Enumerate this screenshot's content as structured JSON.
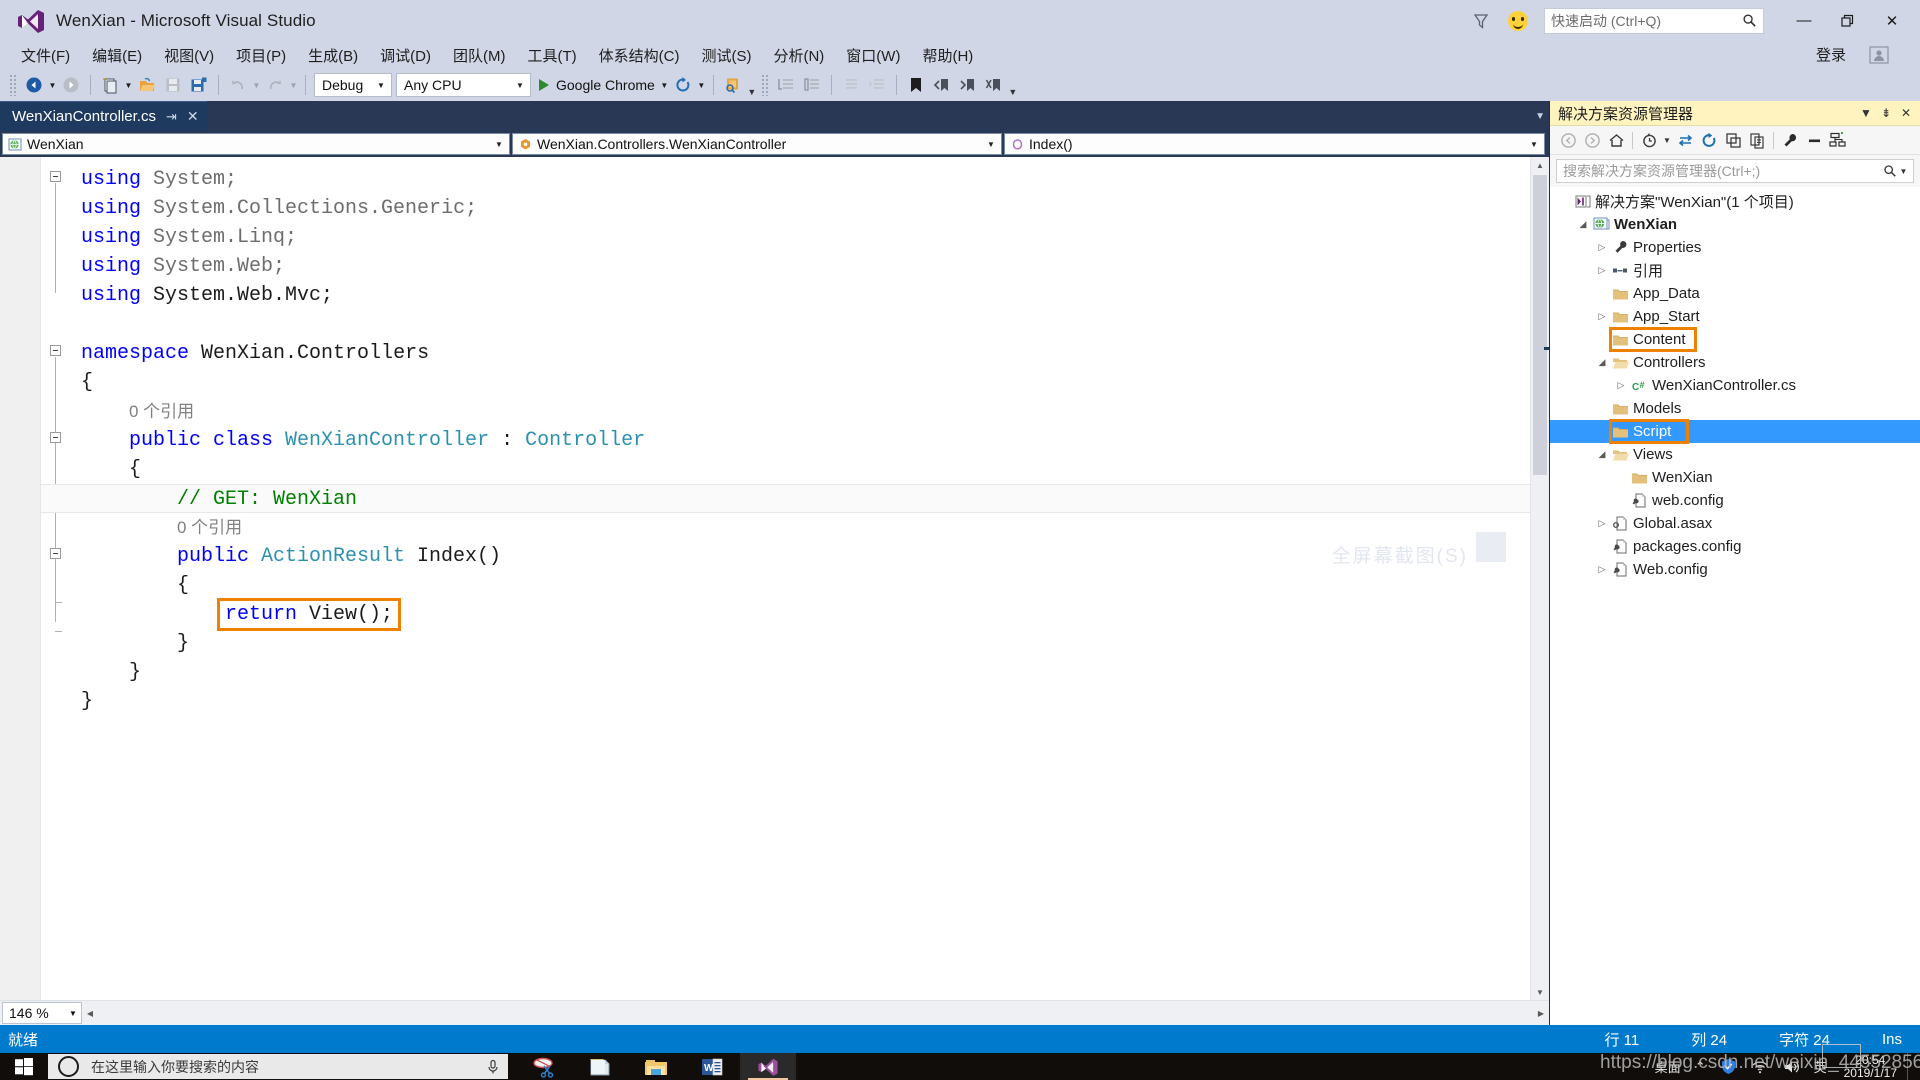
{
  "window": {
    "title": "WenXian - Microsoft Visual Studio",
    "logo_icon": "visual-studio-logo",
    "feedback_icon": "feedback-funnel-icon",
    "smiley_icon": "send-a-smile-icon",
    "minimize": "—",
    "maximize": "❐",
    "close": "✕"
  },
  "quick_launch": {
    "placeholder": "快速启动 (Ctrl+Q)",
    "icon": "search-icon"
  },
  "menu": {
    "items": [
      "文件(F)",
      "编辑(E)",
      "视图(V)",
      "项目(P)",
      "生成(B)",
      "调试(D)",
      "团队(M)",
      "工具(T)",
      "体系结构(C)",
      "测试(S)",
      "分析(N)",
      "窗口(W)",
      "帮助(H)"
    ],
    "signin": "登录",
    "signin_icon": "account-icon"
  },
  "toolbar": {
    "nav_back_icon": "navigate-backward-icon",
    "nav_forward_icon": "navigate-forward-icon",
    "new_project_icon": "new-project-icon",
    "open_file_icon": "open-file-icon",
    "save_icon": "save-icon",
    "save_all_icon": "save-all-icon",
    "undo_icon": "undo-icon",
    "redo_icon": "redo-icon",
    "config": "Debug",
    "platform": "Any CPU",
    "start_label": "Google Chrome",
    "start_icon": "start-debug-icon",
    "refresh_icon": "refresh-icon",
    "find_icon": "find-in-files-icon",
    "comment_icon": "comment-selection-icon",
    "uncomment_icon": "uncomment-selection-icon",
    "indent_icon": "decrease-indent-icon",
    "outdent_icon": "increase-indent-icon",
    "bookmark_icon": "toggle-bookmark-icon",
    "prev_bookmark_icon": "previous-bookmark-icon",
    "next_bookmark_icon": "next-bookmark-icon",
    "clear_bookmarks_icon": "clear-bookmarks-icon",
    "overflow_icon": "toolbar-overflow-icon"
  },
  "editor": {
    "tab_label": "WenXianController.cs",
    "tab_pin_icon": "pin-icon",
    "tab_close_icon": "close-icon",
    "nav": {
      "project": "WenXian",
      "project_icon": "web-project-icon",
      "type": "WenXian.Controllers.WenXianController",
      "type_icon": "class-icon",
      "member": "Index()",
      "member_icon": "method-icon"
    },
    "zoom": "146 %",
    "watermark": "全屏幕截图(S)",
    "code_lines": [
      {
        "indent": 0,
        "segments": [
          {
            "t": "using ",
            "c": "k"
          },
          {
            "t": "System;",
            "c": "dim"
          }
        ]
      },
      {
        "indent": 0,
        "segments": [
          {
            "t": "using ",
            "c": "k"
          },
          {
            "t": "System.Collections.Generic;",
            "c": "dim"
          }
        ]
      },
      {
        "indent": 0,
        "segments": [
          {
            "t": "using ",
            "c": "k"
          },
          {
            "t": "System.Linq;",
            "c": "dim"
          }
        ]
      },
      {
        "indent": 0,
        "segments": [
          {
            "t": "using ",
            "c": "k"
          },
          {
            "t": "System.Web;",
            "c": "dim"
          }
        ]
      },
      {
        "indent": 0,
        "segments": [
          {
            "t": "using ",
            "c": "k"
          },
          {
            "t": "System.Web.Mvc;",
            "c": "id"
          }
        ]
      },
      {
        "indent": 0,
        "segments": []
      },
      {
        "indent": 0,
        "segments": [
          {
            "t": "namespace ",
            "c": "k"
          },
          {
            "t": "WenXian.Controllers",
            "c": "id"
          }
        ]
      },
      {
        "indent": 0,
        "segments": [
          {
            "t": "{",
            "c": "id"
          }
        ]
      },
      {
        "indent": 1,
        "segments": [
          {
            "t": "0 个引用",
            "c": "refs"
          }
        ]
      },
      {
        "indent": 1,
        "segments": [
          {
            "t": "public class ",
            "c": "k"
          },
          {
            "t": "WenXianController",
            "c": "typ"
          },
          {
            "t": " : ",
            "c": "id"
          },
          {
            "t": "Controller",
            "c": "typ"
          }
        ]
      },
      {
        "indent": 1,
        "segments": [
          {
            "t": "{",
            "c": "id"
          }
        ]
      },
      {
        "indent": 2,
        "segments": [
          {
            "t": "// GET: WenXian",
            "c": "cm"
          }
        ],
        "highlight": true
      },
      {
        "indent": 2,
        "segments": [
          {
            "t": "0 个引用",
            "c": "refs"
          }
        ]
      },
      {
        "indent": 2,
        "segments": [
          {
            "t": "public ",
            "c": "k"
          },
          {
            "t": "ActionResult",
            "c": "typ"
          },
          {
            "t": " Index()",
            "c": "id"
          }
        ]
      },
      {
        "indent": 2,
        "segments": [
          {
            "t": "{",
            "c": "id"
          }
        ]
      },
      {
        "indent": 3,
        "segments": [
          {
            "t": "return ",
            "c": "k"
          },
          {
            "t": "View();",
            "c": "id"
          }
        ],
        "boxed": true
      },
      {
        "indent": 2,
        "segments": [
          {
            "t": "}",
            "c": "id"
          }
        ]
      },
      {
        "indent": 1,
        "segments": [
          {
            "t": "}",
            "c": "id"
          }
        ]
      },
      {
        "indent": 0,
        "segments": [
          {
            "t": "}",
            "c": "id"
          }
        ]
      }
    ]
  },
  "solution_explorer": {
    "title": "解决方案资源管理器",
    "dropdown_icon": "chevron-down-icon",
    "pin_icon": "pin-icon",
    "close_icon": "close-icon",
    "toolbar_icons": [
      "back-icon",
      "forward-icon",
      "home-icon",
      "pending-changes-icon",
      "sync-with-active-document-icon",
      "refresh-icon",
      "collapse-all-icon",
      "show-all-files-icon",
      "properties-icon",
      "preview-selected-items-icon",
      "view-class-diagram-icon"
    ],
    "search_placeholder": "搜索解决方案资源管理器(Ctrl+;)",
    "search_icon": "search-icon",
    "tree": [
      {
        "label": "解决方案\"WenXian\"(1 个项目)",
        "depth": 0,
        "expander": "none",
        "icon": "solution-icon"
      },
      {
        "label": "WenXian",
        "depth": 1,
        "expander": "open",
        "icon": "web-project-icon",
        "bold": true
      },
      {
        "label": "Properties",
        "depth": 2,
        "expander": "closed",
        "icon": "properties-icon"
      },
      {
        "label": "引用",
        "depth": 2,
        "expander": "closed",
        "icon": "references-icon"
      },
      {
        "label": "App_Data",
        "depth": 2,
        "expander": "none",
        "icon": "folder-icon"
      },
      {
        "label": "App_Start",
        "depth": 2,
        "expander": "closed",
        "icon": "folder-icon"
      },
      {
        "label": "Content",
        "depth": 2,
        "expander": "none",
        "icon": "folder-icon",
        "outlined": true
      },
      {
        "label": "Controllers",
        "depth": 2,
        "expander": "open",
        "icon": "folder-open-icon"
      },
      {
        "label": "WenXianController.cs",
        "depth": 3,
        "expander": "closed",
        "icon": "csharp-file-icon"
      },
      {
        "label": "Models",
        "depth": 2,
        "expander": "none",
        "icon": "folder-icon"
      },
      {
        "label": "Script",
        "depth": 2,
        "expander": "none",
        "icon": "folder-icon",
        "selected": true,
        "outlined": true
      },
      {
        "label": "Views",
        "depth": 2,
        "expander": "open",
        "icon": "folder-open-icon"
      },
      {
        "label": "WenXian",
        "depth": 3,
        "expander": "none",
        "icon": "folder-icon"
      },
      {
        "label": "web.config",
        "depth": 3,
        "expander": "none",
        "icon": "config-file-icon"
      },
      {
        "label": "Global.asax",
        "depth": 2,
        "expander": "closed",
        "icon": "asax-file-icon"
      },
      {
        "label": "packages.config",
        "depth": 2,
        "expander": "none",
        "icon": "config-file-icon"
      },
      {
        "label": "Web.config",
        "depth": 2,
        "expander": "closed",
        "icon": "config-file-icon"
      }
    ]
  },
  "status_bar": {
    "state": "就绪",
    "line": "行 11",
    "column": "列 24",
    "character": "字符 24",
    "insert_mode": "Ins"
  },
  "taskbar": {
    "start_icon": "windows-start-icon",
    "cortana_icon": "cortana-icon",
    "search_placeholder": "在这里输入你要搜索的内容",
    "mic_icon": "microphone-icon",
    "apps": [
      {
        "icon": "snipping-tool-icon",
        "active": false
      },
      {
        "icon": "notepad-icon",
        "active": false
      },
      {
        "icon": "file-explorer-icon",
        "active": false,
        "running": true
      },
      {
        "icon": "word-icon",
        "active": false,
        "running": true
      },
      {
        "icon": "visual-studio-icon",
        "active": true,
        "running": true
      }
    ],
    "tray": {
      "desktop_label": "桌面",
      "overflow_icon": "chevron-up-icon",
      "security_icon": "shield-icon",
      "network_icon": "wifi-icon",
      "volume_icon": "volume-icon",
      "ime_label": "英",
      "time": "20:54",
      "date": "2019/1/17"
    }
  },
  "watermark": {
    "text": "https://blog.csdn.net/weixin_44552856"
  },
  "colors": {
    "accent": "#007acc",
    "chrome": "#d0d6e5",
    "selection": "#3399ff",
    "outline": "#f08000",
    "tab_active": "#1f3a5f",
    "title_bar_panel": "#fff4bf"
  }
}
